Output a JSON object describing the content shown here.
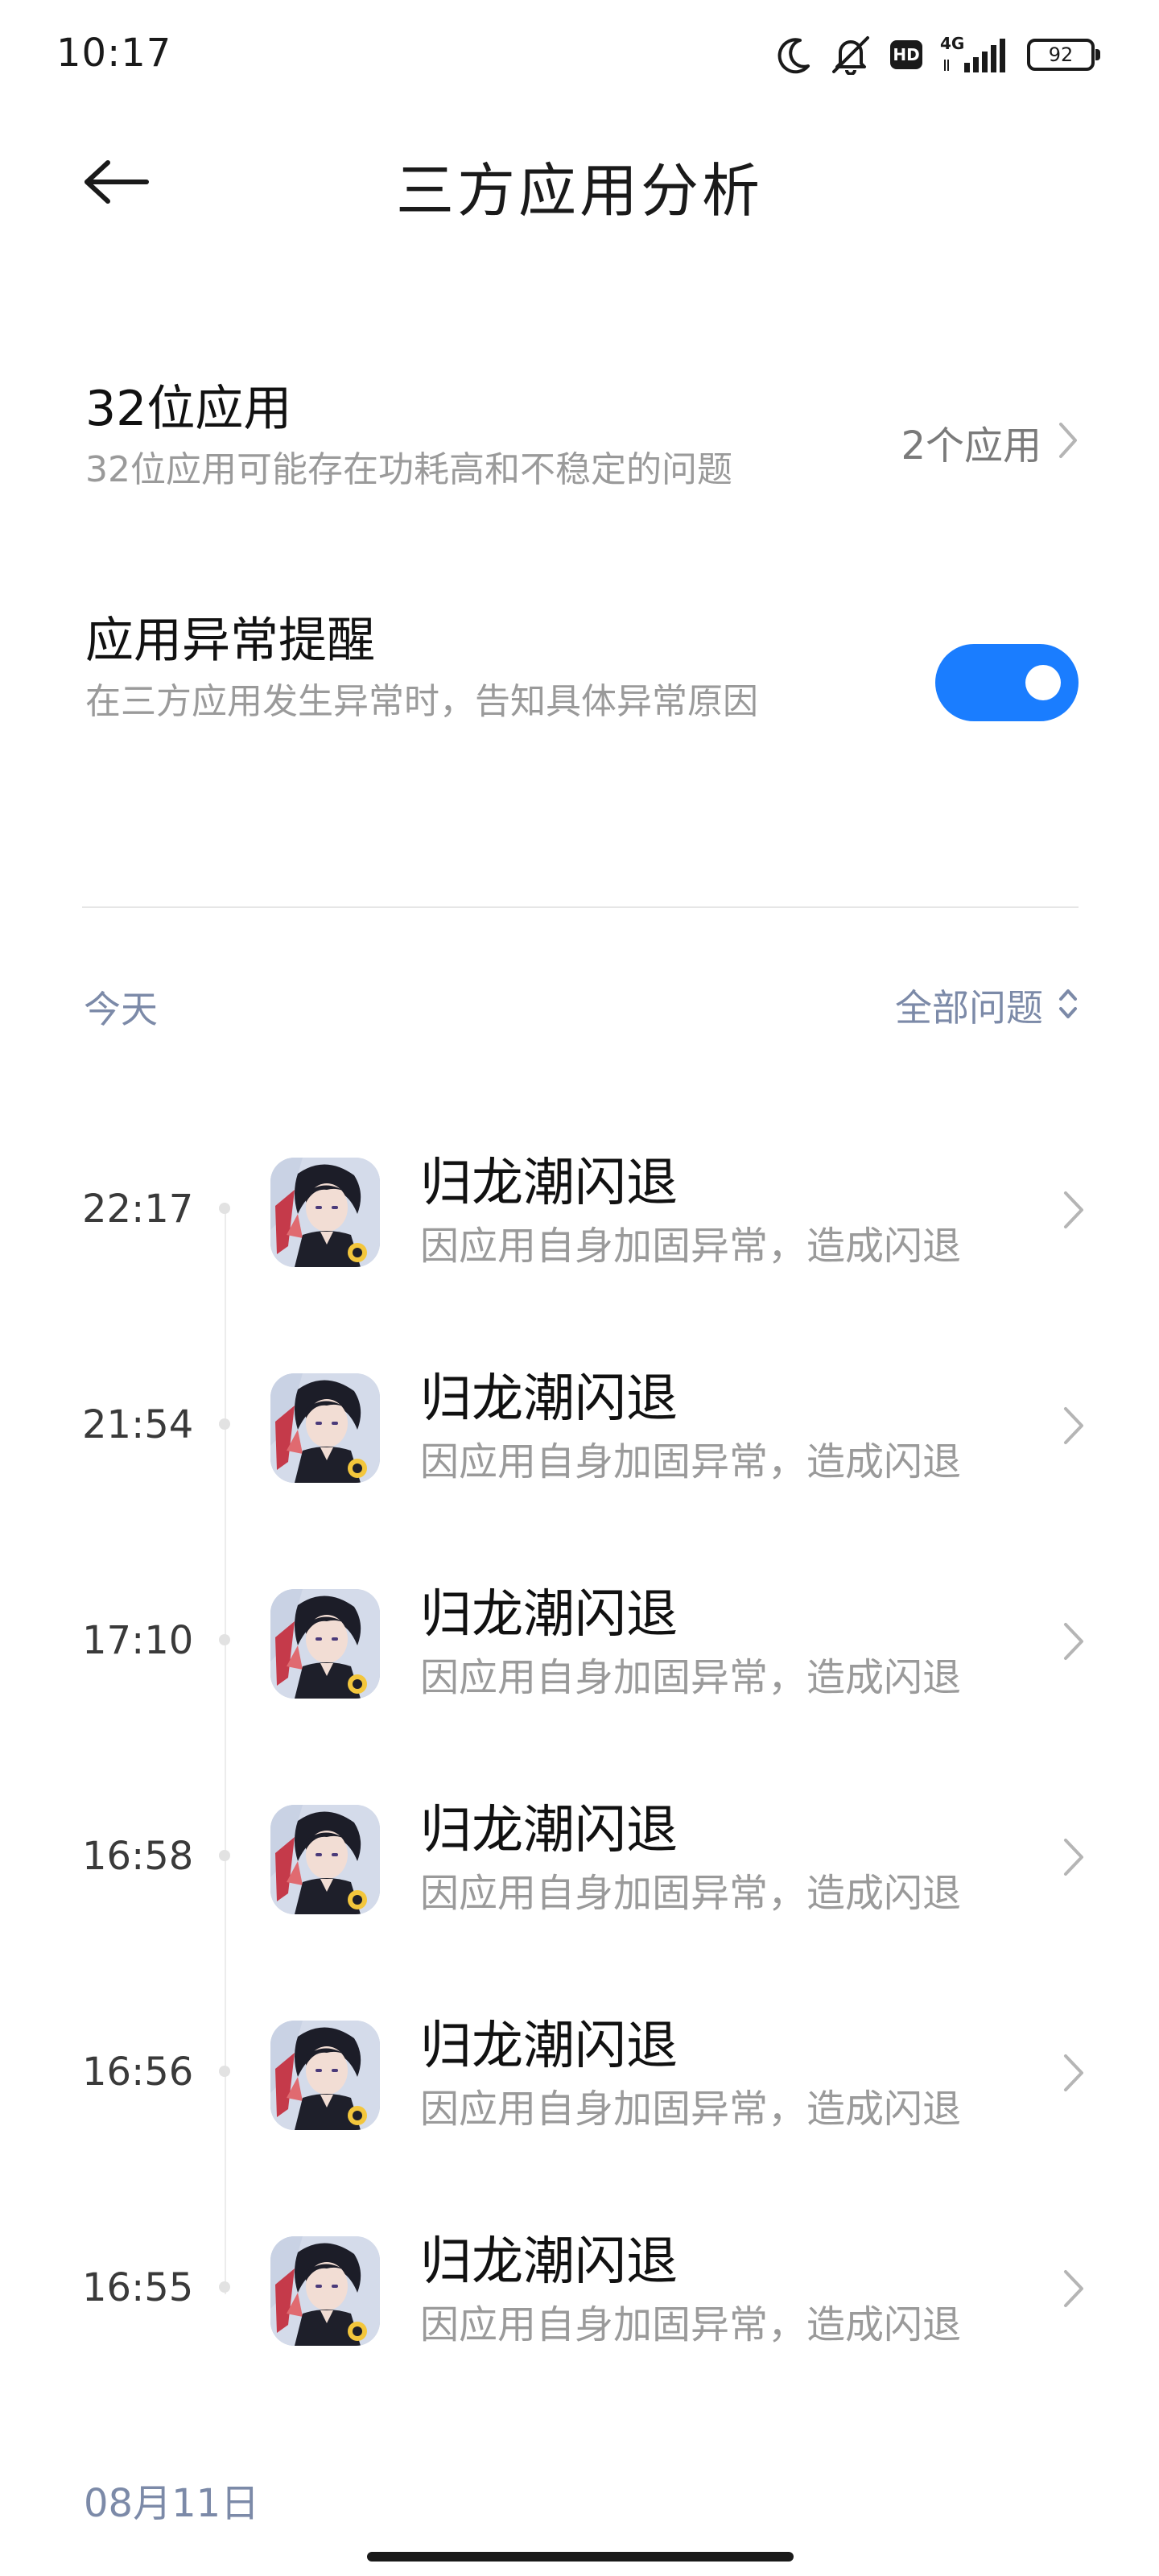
{
  "status_bar": {
    "time": "10:17",
    "hd": "HD",
    "network": "4G",
    "battery": "92"
  },
  "header": {
    "title": "三方应用分析"
  },
  "settings": {
    "bit32": {
      "title": "32位应用",
      "description": "32位应用可能存在功耗高和不稳定的问题",
      "value": "2个应用"
    },
    "abnormal_alert": {
      "title": "应用异常提醒",
      "description": "在三方应用发生异常时，告知具体异常原因",
      "enabled": true,
      "accent_color": "#1a7dff"
    }
  },
  "timeline": {
    "section_label": "今天",
    "filter_label": "全部问题",
    "events": [
      {
        "time": "22:17",
        "title": "归龙潮闪退",
        "description": "因应用自身加固异常，造成闪退",
        "icon": "app-icon"
      },
      {
        "time": "21:54",
        "title": "归龙潮闪退",
        "description": "因应用自身加固异常，造成闪退",
        "icon": "app-icon"
      },
      {
        "time": "17:10",
        "title": "归龙潮闪退",
        "description": "因应用自身加固异常，造成闪退",
        "icon": "app-icon"
      },
      {
        "time": "16:58",
        "title": "归龙潮闪退",
        "description": "因应用自身加固异常，造成闪退",
        "icon": "app-icon"
      },
      {
        "time": "16:56",
        "title": "归龙潮闪退",
        "description": "因应用自身加固异常，造成闪退",
        "icon": "app-icon"
      },
      {
        "time": "16:55",
        "title": "归龙潮闪退",
        "description": "因应用自身加固异常，造成闪退",
        "icon": "app-icon"
      }
    ],
    "next_date_label": "08月11日"
  }
}
